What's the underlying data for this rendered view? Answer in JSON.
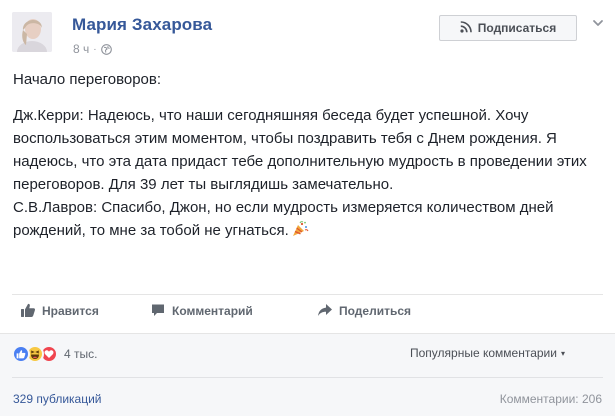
{
  "header": {
    "author": "Мария Захарова",
    "time": "8 ч",
    "separator": "·",
    "privacy_icon": "globe-icon",
    "subscribe_label": "Подписаться",
    "subscribe_icon": "rss-icon",
    "menu_icon": "chevron-down-icon"
  },
  "post": {
    "intro": "Начало переговоров:",
    "paragraph_1": "Дж.Керри: Надеюсь, что наши сегодняшняя беседа будет успешной. Хочу воспользоваться этим моментом, чтобы поздравить тебя с Днем рождения. Я надеюсь, что эта дата придаст тебе дополнительную мудрость в проведении этих переговоров. Для 39 лет ты выглядишь замечательно.",
    "paragraph_2": "С.В.Лавров: Спасибо, Джон, но если мудрость измеряется количеством дней рождений, то мне за тобой не угнаться.",
    "emoji": "party-popper-icon"
  },
  "actions": {
    "like_label": "Нравится",
    "comment_label": "Комментарий",
    "share_label": "Поделиться"
  },
  "footer": {
    "reactions": [
      "like-reaction-icon",
      "haha-reaction-icon",
      "love-reaction-icon"
    ],
    "reaction_count": "4 тыс.",
    "sort_label": "Популярные комментарии",
    "sort_caret": "▾",
    "shares": "329 публикаций",
    "comments": "Комментарии: 206"
  },
  "colors": {
    "link": "#365899",
    "text": "#1d2129",
    "muted": "#90949c",
    "like_blue": "#4a7ff2",
    "love_red": "#f0454f",
    "haha_yellow": "#f7c843"
  }
}
